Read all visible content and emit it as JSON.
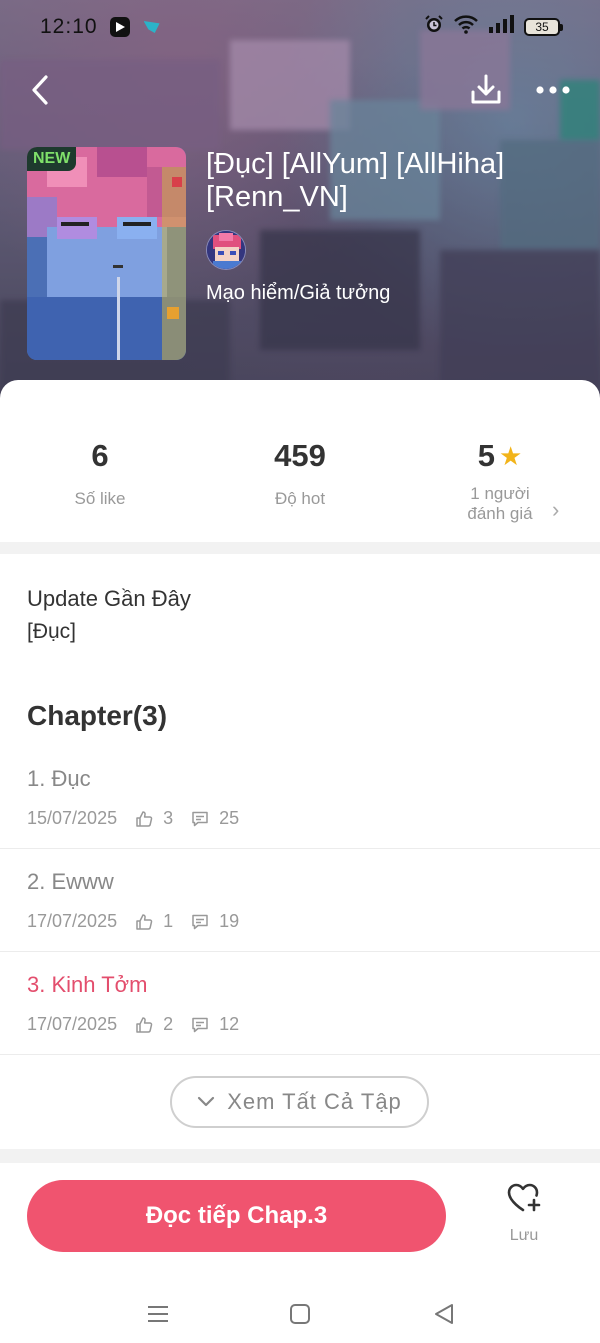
{
  "status_bar": {
    "time": "12:10",
    "battery": "35",
    "icons": [
      "media-app-icon",
      "shop-app-icon",
      "alarm-icon",
      "wifi-icon",
      "signal-icon",
      "battery-icon"
    ]
  },
  "toolbar": {
    "back_icon": "chevron-left-icon",
    "download_icon": "download-icon",
    "more_icon": "more-horizontal-icon"
  },
  "story": {
    "badge": "NEW",
    "title": "[Đục] [AllYum] [AllHiha] [Renn_VN]",
    "genre": "Mạo hiểm/Giả tưởng"
  },
  "stats": {
    "likes_value": "6",
    "likes_label": "Số like",
    "hot_value": "459",
    "hot_label": "Độ hot",
    "rating_value": "5",
    "rating_label_line1": "1 người",
    "rating_label_line2": "đánh giá"
  },
  "update": {
    "heading": "Update Gần Đây",
    "text": "[Đục]"
  },
  "chapters": {
    "heading": "Chapter(3)",
    "items": [
      {
        "title": "1. Đục",
        "date": "15/07/2025",
        "likes": "3",
        "comments": "25"
      },
      {
        "title": "2. Ewww",
        "date": "17/07/2025",
        "likes": "1",
        "comments": "19"
      },
      {
        "title": "3. Kinh Tởm",
        "date": "17/07/2025",
        "likes": "2",
        "comments": "12"
      }
    ],
    "see_all_label": "Xem Tất Cả Tập"
  },
  "actions": {
    "continue_label": "Đọc tiếp Chap.3",
    "save_label": "Lưu"
  },
  "colors": {
    "accent": "#f0546f",
    "current_chapter": "#e34e6d",
    "star": "#f2b41a"
  }
}
